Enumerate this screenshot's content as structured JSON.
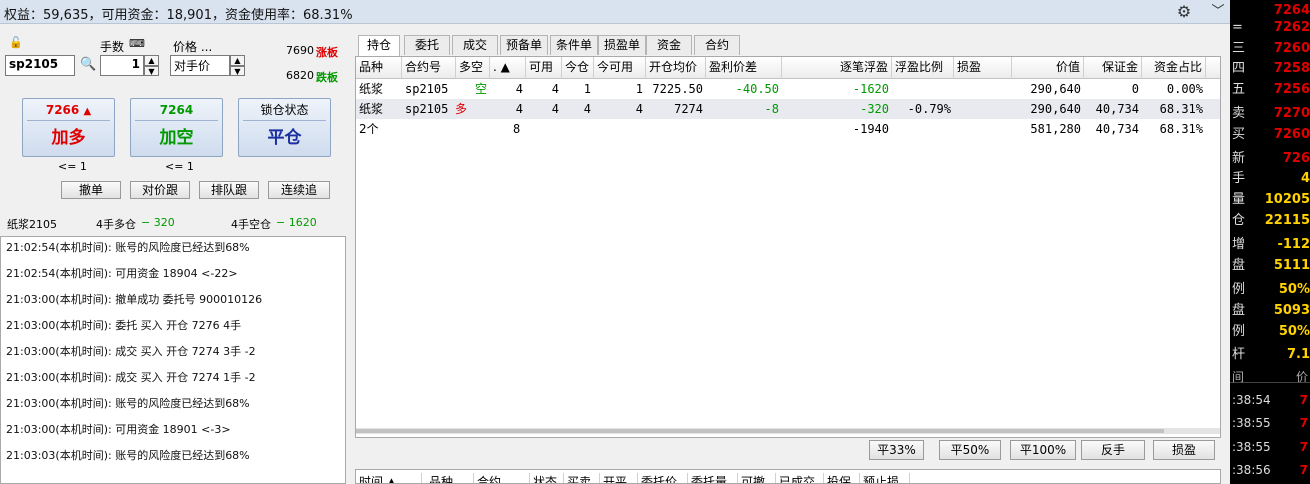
{
  "topbar": {
    "summary": "权益：59,635，可用资金：18,901，资金使用率：68.31%"
  },
  "order": {
    "qty_label": "手数",
    "price_label": "价格 ...",
    "contract": "sp2105",
    "qty": "1",
    "price_type": "对手价",
    "limit_up_price": "7690",
    "limit_up_label": "涨板",
    "limit_down_price": "6820",
    "limit_down_label": "跌板",
    "buy": {
      "price": "7266",
      "arrow": "▲",
      "label": "加多",
      "note": "<= 1"
    },
    "sell": {
      "price": "7264",
      "label": "加空",
      "note": "<= 1"
    },
    "close": {
      "top": "锁仓状态",
      "label": "平仓"
    },
    "buttons": [
      "撤单",
      "对价跟",
      "排队跟",
      "连续追"
    ],
    "pos_name": "纸浆2105",
    "pos_long": "4手多仓",
    "pos_long_pnl": "− 320",
    "pos_short": "4手空仓",
    "pos_short_pnl": "− 1620"
  },
  "log": [
    "21:02:54(本机时间): 账号的风险度已经达到68%",
    "21:02:54(本机时间): 可用资金 18904 <-22>",
    "21:03:00(本机时间): 撤单成功 委托号 900010126",
    "21:03:00(本机时间): 委托 买入 开仓 7276 4手",
    "21:03:00(本机时间): 成交 买入 开仓 7274 3手 -2",
    "21:03:00(本机时间): 成交 买入 开仓 7274 1手 -2",
    "21:03:00(本机时间): 账号的风险度已经达到68%",
    "21:03:00(本机时间): 可用资金 18901 <-3>",
    "21:03:03(本机时间): 账号的风险度已经达到68%"
  ],
  "tabs": [
    "持仓",
    "委托",
    "成交",
    "预备单",
    "条件单",
    "损盈单",
    "资金",
    "合约"
  ],
  "positions": {
    "headers": [
      "品种",
      "合约号",
      "多空",
      ". ▲",
      "可用",
      "今仓",
      "今可用",
      "开仓均价",
      "盈利价差",
      "逐笔浮盈",
      "浮盈比例",
      "损盈",
      "价值",
      "保证金",
      "资金占比"
    ],
    "rows": [
      [
        "纸浆",
        "sp2105",
        "空",
        "4",
        "4",
        "1",
        "1",
        "7225.50",
        "-40.50",
        "-1620",
        "",
        "",
        "290,640",
        "0",
        "0.00%"
      ],
      [
        "纸浆",
        "sp2105",
        "多",
        "4",
        "4",
        "4",
        "4",
        "7274",
        "-8",
        "-320",
        "-0.79%",
        "",
        "290,640",
        "40,734",
        "68.31%"
      ],
      [
        "2个",
        "",
        "",
        "8",
        "",
        "",
        "",
        "",
        "",
        "-1940",
        "",
        "",
        "581,280",
        "40,734",
        "68.31%"
      ]
    ]
  },
  "pos_buttons": [
    "平33%",
    "平50%",
    "平100%",
    "反手",
    "损盈"
  ],
  "orders_headers": [
    "时间 ▲",
    "品种",
    "合约",
    "状态",
    "买卖",
    "开平",
    "委托价",
    "委托量",
    "可撤",
    "已成交",
    "投保",
    "预止损"
  ],
  "quote": {
    "rows": [
      {
        "k": "",
        "v": "7264"
      },
      {
        "k": "=",
        "v": "7262"
      },
      {
        "k": "三",
        "v": "7260"
      },
      {
        "k": "四",
        "v": "7258"
      },
      {
        "k": "五",
        "v": "7256"
      },
      {
        "k": "卖",
        "v": "7270"
      },
      {
        "k": "买",
        "v": "7260"
      },
      {
        "k": "新",
        "v": "726"
      },
      {
        "k": "手",
        "v": "4"
      },
      {
        "k": "量",
        "v": "10205"
      },
      {
        "k": "仓",
        "v": "22115"
      },
      {
        "k": "增",
        "v": "-112"
      },
      {
        "k": "盘",
        "v": "5111"
      },
      {
        "k": "例",
        "v": "50%"
      },
      {
        "k": "盘",
        "v": "5093"
      },
      {
        "k": "例",
        "v": "50%"
      },
      {
        "k": "杆",
        "v": "7.1"
      }
    ],
    "ticks_header": {
      "time": "间",
      "price": "价"
    },
    "ticks": [
      {
        "t": ":38:54",
        "p": "7"
      },
      {
        "t": ":38:55",
        "p": "7"
      },
      {
        "t": ":38:55",
        "p": "7"
      },
      {
        "t": ":38:56",
        "p": "7"
      }
    ]
  },
  "colors": {
    "red": "#e00000",
    "green": "#009a00",
    "yellow": "#ffd200"
  }
}
